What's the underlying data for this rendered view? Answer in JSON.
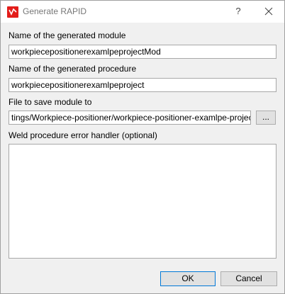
{
  "window": {
    "title": "Generate RAPID",
    "app_icon": "abb-robotstudio-icon",
    "help_glyph": "?",
    "close_icon": "close-icon"
  },
  "form": {
    "module_name": {
      "label": "Name of the generated module",
      "value": "workpiecepositionerexamlpeprojectMod"
    },
    "procedure_name": {
      "label": "Name of the generated procedure",
      "value": "workpiecepositionerexamlpeproject"
    },
    "save_file": {
      "label": "File to save module to",
      "value": "tings/Workpiece-positioner/workpiece-positioner-examlpe-project.mod",
      "browse_label": "..."
    },
    "error_handler": {
      "label": "Weld procedure error handler (optional)",
      "value": ""
    }
  },
  "buttons": {
    "ok": "OK",
    "cancel": "Cancel"
  },
  "colors": {
    "accent": "#0078d7",
    "brand_red": "#e31d1a",
    "dialog_bg": "#f0f0f0"
  }
}
